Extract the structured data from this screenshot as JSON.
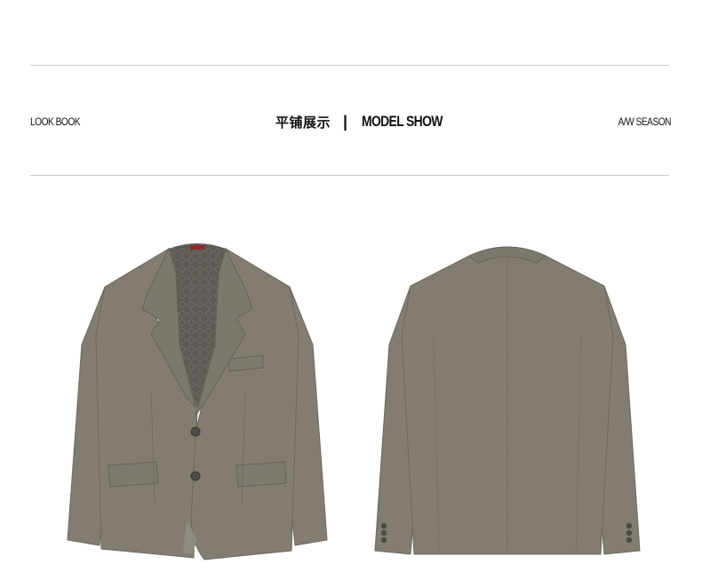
{
  "header": {
    "left_label": "LOOK BOOK",
    "center_cn": "平铺展示",
    "separator": "|",
    "center_en": "MODEL SHOW",
    "right_label": "A/W SEASON"
  },
  "products": [
    {
      "view": "front",
      "icon": "blazer-front-image"
    },
    {
      "view": "back",
      "icon": "blazer-back-image"
    }
  ],
  "colors": {
    "background": "#ffffff",
    "rule": "#c9c9c9",
    "fabric": "#857f74",
    "fabric_dark": "#6d685f",
    "lining": "#5b5752",
    "text": "#111111"
  }
}
